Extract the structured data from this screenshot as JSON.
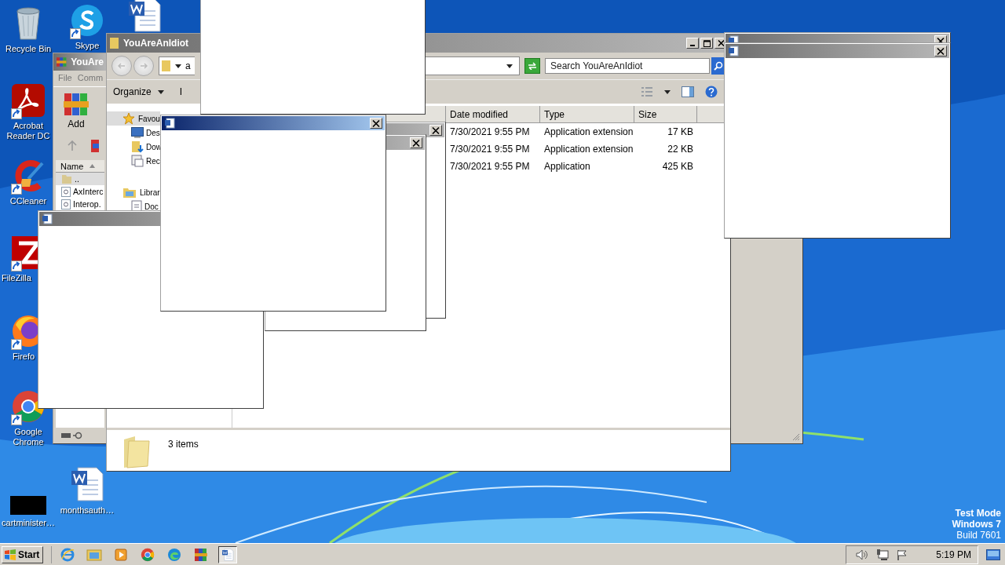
{
  "desktop_icons": [
    {
      "kind": "recycle",
      "label": "Recycle Bin",
      "shortcut": false
    },
    {
      "kind": "acrobat",
      "label": "Acrobat Reader DC",
      "shortcut": true
    },
    {
      "kind": "ccleaner",
      "label": "CCleaner",
      "shortcut": true
    },
    {
      "kind": "filezilla",
      "label": "FileZilla",
      "shortcut": true
    },
    {
      "kind": "firefox",
      "label": "Firefo",
      "shortcut": true
    },
    {
      "kind": "chrome",
      "label": "Google Chrome",
      "shortcut": true
    },
    {
      "kind": "black",
      "label": "cartminister…",
      "shortcut": false
    },
    {
      "kind": "skype",
      "label": "Skype",
      "shortcut": true
    },
    {
      "kind": "word",
      "shortcut": false
    },
    {
      "kind": "word",
      "label": "monthsauth…",
      "shortcut": false
    }
  ],
  "winrar": {
    "title": "YouAre",
    "menu": [
      "File",
      "Comm"
    ],
    "toolbar_button": "Add",
    "column": "Name",
    "rows": [
      "..",
      "AxInterc",
      "Interop."
    ]
  },
  "explorer": {
    "title": "YouAreAnIdiot",
    "address": "a",
    "search_placeholder": "Search YouAreAnIdiot",
    "toolbar": [
      "Organize",
      "I"
    ],
    "nav": [
      {
        "label": "Favou",
        "kind": "star",
        "selected": true,
        "children": [
          {
            "label": "Des",
            "kind": "desktop",
            "selected": false
          },
          {
            "label": "Dow",
            "kind": "download",
            "selected": false
          },
          {
            "label": "Rec",
            "kind": "recent",
            "selected": false
          }
        ]
      },
      {
        "label": "Librar",
        "kind": "library",
        "selected": false,
        "children": [
          {
            "label": "Doc",
            "kind": "doc",
            "selected": false
          }
        ]
      }
    ],
    "columns": [
      "Date modified",
      "Type",
      "Size"
    ],
    "rows": [
      {
        "date": "7/30/2021 9:55 PM",
        "type": "Application extension",
        "size": "17 KB"
      },
      {
        "date": "7/30/2021 9:55 PM",
        "type": "Application extension",
        "size": "22 KB"
      },
      {
        "date": "7/30/2021 9:55 PM",
        "type": "Application",
        "size": "425 KB"
      }
    ],
    "status": "3 items"
  },
  "popups": [
    {
      "kind": "frame"
    },
    {
      "kind": "dialog",
      "active": false
    },
    {
      "kind": "dialog",
      "active": false
    },
    {
      "kind": "dialog",
      "active": false
    },
    {
      "kind": "dialog",
      "active": true
    },
    {
      "kind": "dialog",
      "active": false
    },
    {
      "kind": "dialog",
      "active": false
    }
  ],
  "test_mode": [
    "Test Mode",
    "Windows 7",
    "Build 7601"
  ],
  "taskbar": {
    "start": "Start",
    "apps": [
      {
        "kind": "ie",
        "active": false
      },
      {
        "kind": "folder",
        "active": false
      },
      {
        "kind": "media",
        "active": false
      },
      {
        "kind": "chrome",
        "active": false
      },
      {
        "kind": "edge",
        "active": false
      },
      {
        "kind": "winrar",
        "active": false
      },
      {
        "kind": "word",
        "active": true
      }
    ],
    "clock": "5:19 PM"
  }
}
